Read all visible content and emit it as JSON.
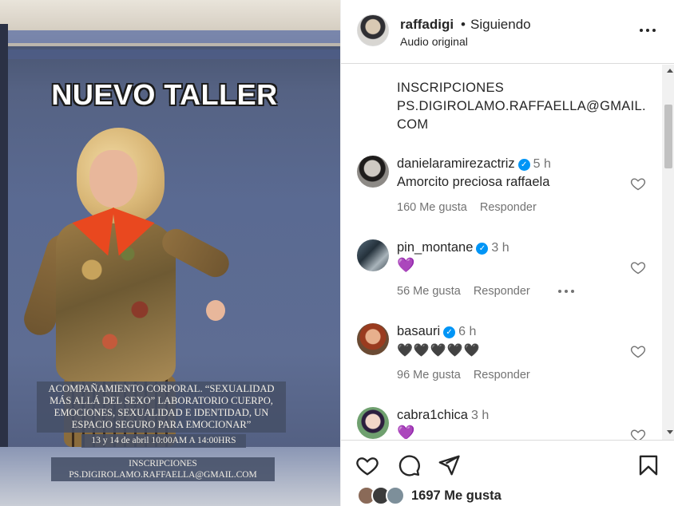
{
  "video": {
    "title": "NUEVO TALLER",
    "caption_line1": "ACOMPAÑAMIENTO CORPORAL. “SEXUALIDAD MÁS ALLÁ DEL SEXO” LABORATORIO CUERPO, EMOCIONES, SEXUALIDAD E IDENTIDAD, UN ESPACIO SEGURO PARA EMOCIONAR”",
    "caption_line2": "13 y 14 de abril 10:00AM A 14:00HRS",
    "caption_line3": "INSCRIPCIONES PS.DIGIROLAMO.RAFFAELLA@GMAIL.COM"
  },
  "header": {
    "username": "raffadigi",
    "separator": "•",
    "follow_status": "Siguiendo",
    "subtitle": "Audio original"
  },
  "post_caption": {
    "line1": "INSCRIPCIONES",
    "line2": "PS.DIGIROLAMO.RAFFAELLA@GMAIL.",
    "line3": "COM"
  },
  "comments": [
    {
      "username": "danielaramirezactriz",
      "verified": true,
      "time": "5 h",
      "text": "Amorcito preciosa raffaela",
      "likes": "160 Me gusta",
      "reply": "Responder"
    },
    {
      "username": "pin_montane",
      "verified": true,
      "time": "3 h",
      "text": "💜",
      "likes": "56 Me gusta",
      "reply": "Responder"
    },
    {
      "username": "basauri",
      "verified": true,
      "time": "6 h",
      "text": "🖤🖤🖤🖤🖤",
      "likes": "96 Me gusta",
      "reply": "Responder"
    },
    {
      "username": "cabra1chica",
      "verified": false,
      "time": "3 h",
      "text": "💜"
    }
  ],
  "footer": {
    "likes_count": "1697 Me gusta"
  },
  "colors": {
    "verified_blue": "#0095f6",
    "text_primary": "#262626",
    "text_secondary": "#737373",
    "divider": "#dbdbdb"
  },
  "icons": [
    "heart-icon",
    "comment-icon",
    "share-icon",
    "bookmark-icon",
    "more-options-icon",
    "verified-badge-icon"
  ]
}
